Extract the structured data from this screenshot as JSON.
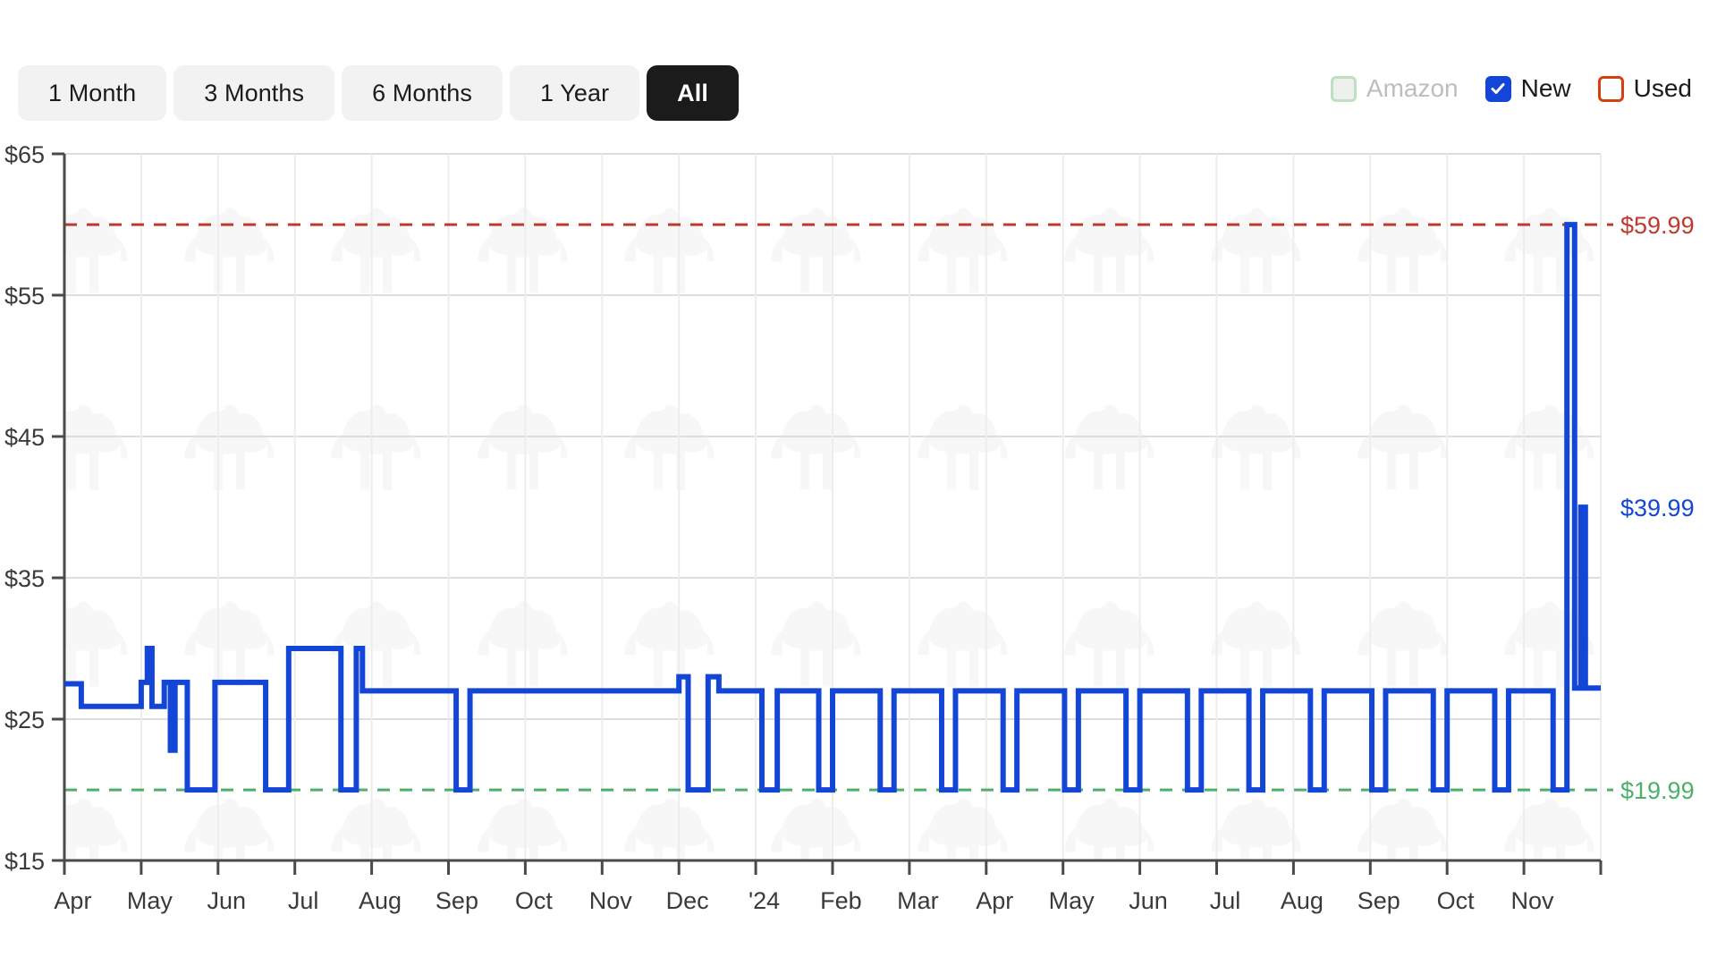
{
  "toolbar": {
    "ranges": [
      {
        "label": "1 Month",
        "active": false
      },
      {
        "label": "3 Months",
        "active": false
      },
      {
        "label": "6 Months",
        "active": false
      },
      {
        "label": "1 Year",
        "active": false
      },
      {
        "label": "All",
        "active": true
      }
    ],
    "legend": [
      {
        "label": "Amazon",
        "state": "disabled",
        "checked": false,
        "color": "#bfe0c0"
      },
      {
        "label": "New",
        "state": "enabled",
        "checked": true,
        "color": "#1346d6"
      },
      {
        "label": "Used",
        "state": "enabled",
        "checked": false,
        "color": "#d6400f"
      }
    ]
  },
  "chart_data": {
    "type": "line",
    "title": "",
    "xlabel": "",
    "ylabel": "",
    "grid": true,
    "legend_position": "top-right",
    "ylim": [
      15,
      65
    ],
    "ytick_labels": [
      "$65",
      "$55",
      "$45",
      "$35",
      "$25",
      "$15"
    ],
    "ytick_values": [
      65,
      55,
      45,
      35,
      25,
      15
    ],
    "xtick_labels": [
      "Apr",
      "May",
      "Jun",
      "Jul",
      "Aug",
      "Sep",
      "Oct",
      "Nov",
      "Dec",
      "'24",
      "Feb",
      "Mar",
      "Apr",
      "May",
      "Jun",
      "Jul",
      "Aug",
      "Sep",
      "Oct",
      "Nov"
    ],
    "reference_lines": [
      {
        "label": "$59.99",
        "value": 59.99,
        "color": "#c0392b",
        "style": "dashed",
        "name": "highest-price"
      },
      {
        "label": "$19.99",
        "value": 19.99,
        "color": "#4caf6a",
        "style": "dashed",
        "name": "lowest-price"
      }
    ],
    "annotations": [
      {
        "label": "$59.99",
        "value": 59.99,
        "color": "#c0392b"
      },
      {
        "label": "$39.99",
        "value": 39.99,
        "color": "#1346d6"
      },
      {
        "label": "$19.99",
        "value": 19.99,
        "color": "#4caf6a"
      }
    ],
    "series": [
      {
        "name": "New",
        "color": "#1346d6",
        "step": "post",
        "points": [
          [
            0.0,
            27.5
          ],
          [
            0.22,
            27.5
          ],
          [
            0.22,
            25.9
          ],
          [
            1.0,
            25.9
          ],
          [
            1.0,
            27.6
          ],
          [
            1.08,
            27.6
          ],
          [
            1.08,
            30.0
          ],
          [
            1.14,
            30.0
          ],
          [
            1.14,
            25.9
          ],
          [
            1.3,
            25.9
          ],
          [
            1.3,
            27.6
          ],
          [
            1.38,
            27.6
          ],
          [
            1.38,
            22.8
          ],
          [
            1.44,
            22.8
          ],
          [
            1.44,
            27.6
          ],
          [
            1.6,
            27.6
          ],
          [
            1.6,
            19.99
          ],
          [
            1.96,
            19.99
          ],
          [
            1.96,
            27.6
          ],
          [
            2.62,
            27.6
          ],
          [
            2.62,
            19.99
          ],
          [
            2.92,
            19.99
          ],
          [
            2.92,
            30.0
          ],
          [
            3.6,
            30.0
          ],
          [
            3.6,
            19.99
          ],
          [
            3.8,
            19.99
          ],
          [
            3.8,
            30.0
          ],
          [
            3.88,
            30.0
          ],
          [
            3.88,
            27.0
          ],
          [
            5.1,
            27.0
          ],
          [
            5.1,
            19.99
          ],
          [
            5.28,
            19.99
          ],
          [
            5.28,
            27.0
          ],
          [
            8.0,
            27.0
          ],
          [
            8.0,
            28.0
          ],
          [
            8.12,
            28.0
          ],
          [
            8.12,
            19.99
          ],
          [
            8.38,
            19.99
          ],
          [
            8.38,
            28.0
          ],
          [
            8.52,
            28.0
          ],
          [
            8.52,
            27.0
          ],
          [
            9.08,
            27.0
          ],
          [
            9.08,
            19.99
          ],
          [
            9.28,
            19.99
          ],
          [
            9.28,
            27.0
          ],
          [
            9.82,
            27.0
          ],
          [
            9.82,
            19.99
          ],
          [
            10.0,
            19.99
          ],
          [
            10.0,
            27.0
          ],
          [
            10.62,
            27.0
          ],
          [
            10.62,
            19.99
          ],
          [
            10.8,
            19.99
          ],
          [
            10.8,
            27.0
          ],
          [
            11.42,
            27.0
          ],
          [
            11.42,
            19.99
          ],
          [
            11.6,
            19.99
          ],
          [
            11.6,
            27.0
          ],
          [
            12.22,
            27.0
          ],
          [
            12.22,
            19.99
          ],
          [
            12.4,
            19.99
          ],
          [
            12.4,
            27.0
          ],
          [
            13.02,
            27.0
          ],
          [
            13.02,
            19.99
          ],
          [
            13.2,
            19.99
          ],
          [
            13.2,
            27.0
          ],
          [
            13.82,
            27.0
          ],
          [
            13.82,
            19.99
          ],
          [
            14.0,
            19.99
          ],
          [
            14.0,
            27.0
          ],
          [
            14.62,
            27.0
          ],
          [
            14.62,
            19.99
          ],
          [
            14.8,
            19.99
          ],
          [
            14.8,
            27.0
          ],
          [
            15.42,
            27.0
          ],
          [
            15.42,
            19.99
          ],
          [
            15.6,
            19.99
          ],
          [
            15.6,
            27.0
          ],
          [
            16.22,
            27.0
          ],
          [
            16.22,
            19.99
          ],
          [
            16.4,
            19.99
          ],
          [
            16.4,
            27.0
          ],
          [
            17.02,
            27.0
          ],
          [
            17.02,
            19.99
          ],
          [
            17.2,
            19.99
          ],
          [
            17.2,
            27.0
          ],
          [
            17.82,
            27.0
          ],
          [
            17.82,
            19.99
          ],
          [
            18.0,
            19.99
          ],
          [
            18.0,
            27.0
          ],
          [
            18.62,
            27.0
          ],
          [
            18.62,
            19.99
          ],
          [
            18.8,
            19.99
          ],
          [
            18.8,
            27.0
          ],
          [
            19.38,
            27.0
          ],
          [
            19.38,
            19.99
          ],
          [
            19.56,
            19.99
          ],
          [
            19.56,
            59.99
          ],
          [
            19.66,
            59.99
          ],
          [
            19.66,
            27.2
          ],
          [
            19.74,
            27.2
          ],
          [
            19.74,
            39.99
          ],
          [
            19.8,
            39.99
          ],
          [
            19.8,
            27.2
          ],
          [
            20.0,
            27.2
          ]
        ]
      }
    ]
  }
}
